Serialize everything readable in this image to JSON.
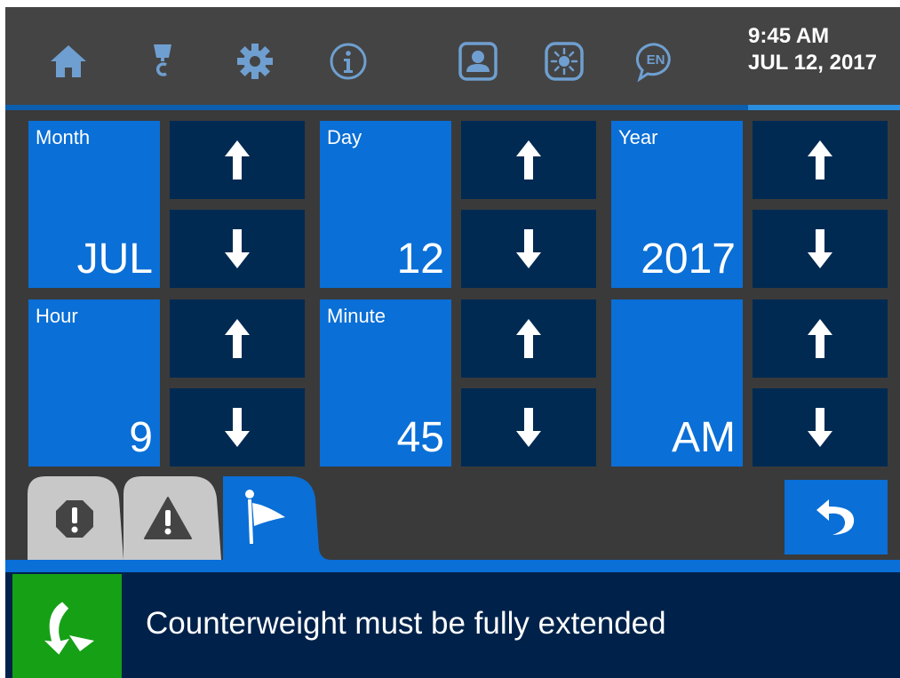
{
  "colors": {
    "topbar": "#444444",
    "background": "#3a3a3a",
    "value_tile": "#0a6fd6",
    "arrow_button": "#002a52",
    "message_bar": "#00224a",
    "message_icon_bg": "#16a016",
    "tab_inactive": "#c8c8c8",
    "tab_active": "#0a6fd6"
  },
  "topbar": {
    "icons": [
      {
        "name": "home-icon"
      },
      {
        "name": "crane-hook-icon"
      },
      {
        "name": "gear-icon"
      },
      {
        "name": "info-icon"
      },
      {
        "name": "operator-profile-icon"
      },
      {
        "name": "brightness-icon"
      },
      {
        "name": "language-icon",
        "text": "EN"
      }
    ],
    "time": "9:45 AM",
    "date": "JUL 12, 2017",
    "progress_fraction": 0.83
  },
  "fields": [
    {
      "label": "Month",
      "value": "JUL"
    },
    {
      "label": "Day",
      "value": "12"
    },
    {
      "label": "Year",
      "value": "2017"
    },
    {
      "label": "Hour",
      "value": "9"
    },
    {
      "label": "Minute",
      "value": "45"
    },
    {
      "label": "",
      "value": "AM"
    }
  ],
  "arrows": {
    "up_icon": "arrow-up-icon",
    "down_icon": "arrow-down-icon"
  },
  "tabs": [
    {
      "name": "tab-errors",
      "icon": "stop-alert-icon",
      "active": false
    },
    {
      "name": "tab-warnings",
      "icon": "warning-triangle-icon",
      "active": false
    },
    {
      "name": "tab-info-flags",
      "icon": "flag-icon",
      "active": true
    }
  ],
  "back_button": {
    "icon": "return-arrow-icon"
  },
  "message": {
    "icon": "turn-arrow-icon",
    "text": "Counterweight must be fully extended"
  }
}
